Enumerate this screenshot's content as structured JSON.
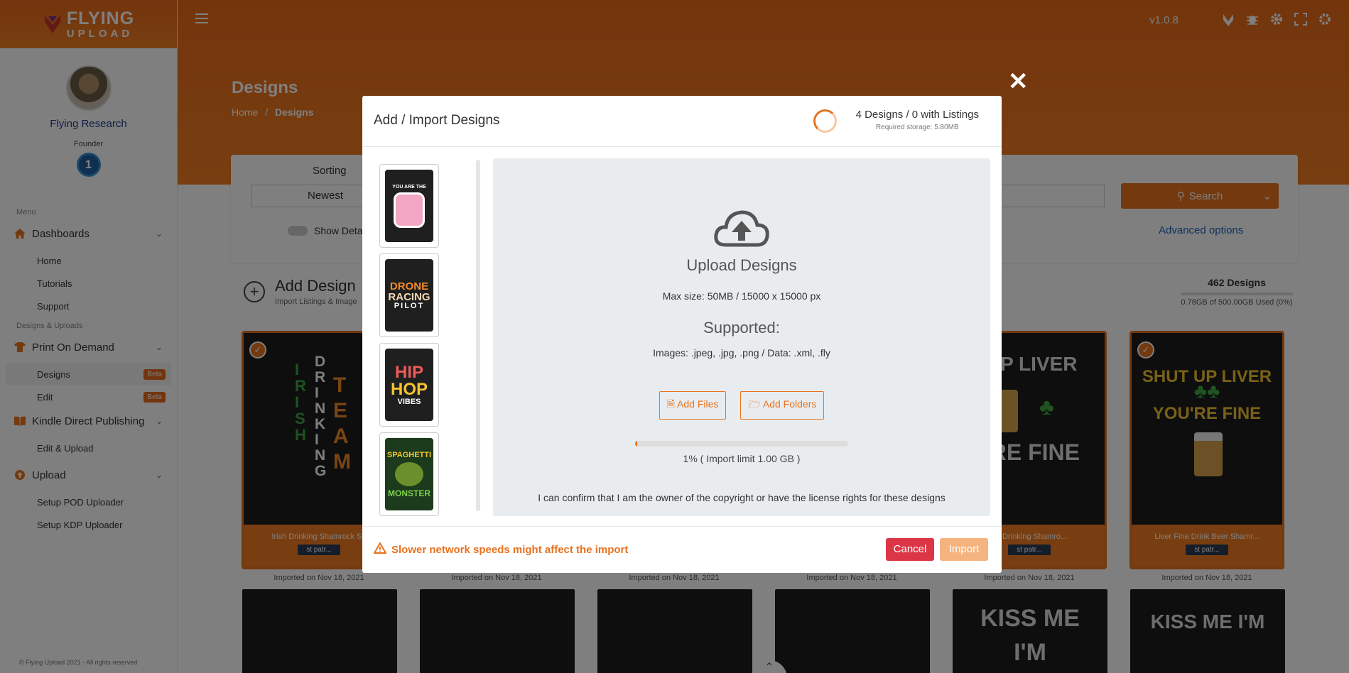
{
  "brand": {
    "line1": "FLYING",
    "line2": "UPLOAD",
    "version": "v1.0.8"
  },
  "profile": {
    "name": "Flying Research",
    "role": "Founder",
    "level": "1"
  },
  "sidebar": {
    "menu_label": "Menu",
    "dashboards": "Dashboards",
    "dash_items": [
      "Home",
      "Tutorials",
      "Support"
    ],
    "uploads_label": "Designs & Uploads",
    "pod": "Print On Demand",
    "pod_items": [
      "Designs",
      "Edit"
    ],
    "beta": "Beta",
    "kdp": "Kindle Direct Publishing",
    "kdp_items": [
      "Edit & Upload"
    ],
    "upload": "Upload",
    "upload_items": [
      "Setup POD Uploader",
      "Setup KDP Uploader"
    ],
    "copyright": "© Flying Upload 2021 - All rights reserved"
  },
  "page": {
    "title": "Designs",
    "crumb_home": "Home",
    "crumb_sep": "/",
    "crumb_current": "Designs"
  },
  "filters": {
    "sorting_label": "Sorting",
    "sorting_value": "Newest",
    "show_details": "Show Deta",
    "search": "Search",
    "advanced": "Advanced options"
  },
  "add": {
    "title": "Add Design",
    "subtitle": "Import Listings & Image"
  },
  "stats": {
    "count": "462 Designs",
    "storage": "0.78GB of 500.00GB Used (0%)"
  },
  "cards": [
    {
      "title": "Irish Drinking Shamrock Sa",
      "tag": "st patr...",
      "date": "Imported on Nov 18, 2021"
    },
    {
      "date": "Imported on Nov 18, 2021"
    },
    {
      "date": "Imported on Nov 18, 2021"
    },
    {
      "date": "Imported on Nov 18, 2021"
    },
    {
      "title": "ne Drinking Shamro...",
      "tag": "st patr...",
      "date": "Imported on Nov 18, 2021"
    },
    {
      "title": "Liver Fine Drink Beer Shamr...",
      "tag": "st patr...",
      "date": "Imported on Nov 18, 2021"
    }
  ],
  "modal": {
    "title": "Add / Import Designs",
    "count": "4 Designs / 0 with Listings",
    "storage": "Required storage: 5.80MB",
    "upload_title": "Upload Designs",
    "max_size": "Max size: 50MB / 15000 x 15000 px",
    "supported": "Supported:",
    "formats": "Images: .jpeg, .jpg, .png / Data: .xml, .fly",
    "add_files": "Add Files",
    "add_folders": "Add Folders",
    "progress": 0.01,
    "progress_text": "1% ( Import limit 1.00 GB )",
    "confirm": "I can confirm that I am the owner of the copyright or have the license rights for these designs",
    "warning": "Slower network speeds might affect the import",
    "cancel": "Cancel",
    "import": "Import",
    "thumb_texts": [
      "YOU ARE THE",
      "DRONE",
      "RACING",
      "PILOT",
      "HIP",
      "HOP",
      "VIBES",
      "SPAGHETTI",
      "MONSTER"
    ]
  },
  "card_texts": {
    "irish": [
      "I",
      "R",
      "I",
      "S",
      "H"
    ],
    "drinking": [
      "D",
      "R",
      "I",
      "N",
      "K",
      "I",
      "N",
      "G"
    ],
    "team": [
      "T",
      "E",
      "A",
      "M"
    ],
    "liver1": [
      "T UP LIVER",
      "U'RE FINE"
    ],
    "liver2": [
      "SHUT UP LIVER",
      "YOU'RE FINE"
    ],
    "kiss1": [
      "KISS ME",
      "I'M"
    ],
    "kiss2": "KISS ME I'M"
  },
  "colors": {
    "accent": "#e8721f",
    "cancel": "#dc3545",
    "link": "#1d63b8"
  }
}
